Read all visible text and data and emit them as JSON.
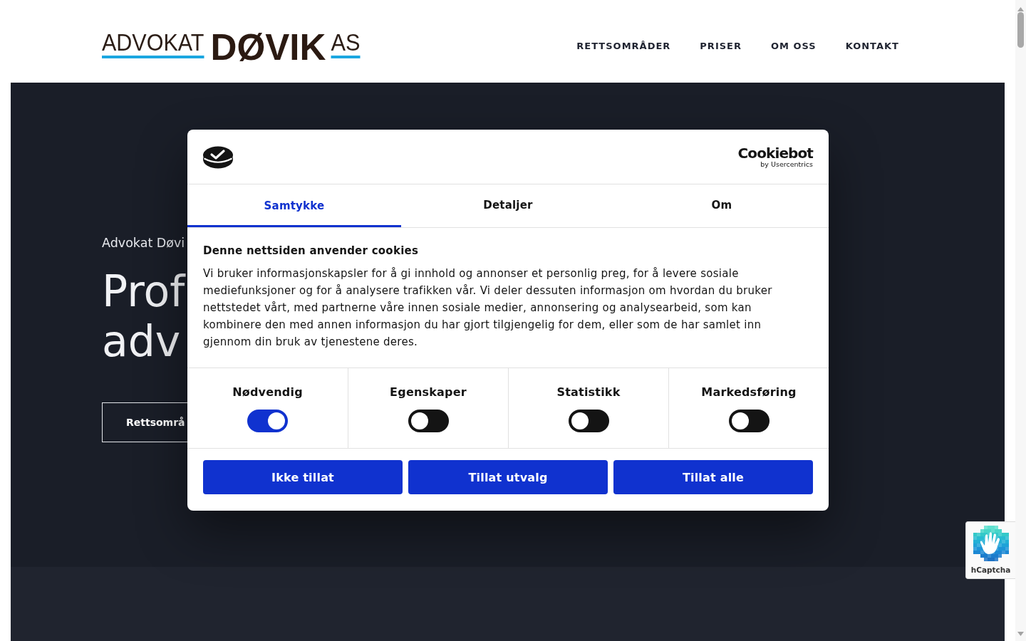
{
  "header": {
    "logo": {
      "words": [
        {
          "text": "ADVOKAT",
          "kind": "thin"
        },
        {
          "text": "DØVIK",
          "kind": "bold"
        },
        {
          "text": "AS",
          "kind": "thin"
        }
      ]
    },
    "nav": [
      "RETTSOMRÅDER",
      "PRISER",
      "OM OSS",
      "KONTAKT"
    ]
  },
  "hero": {
    "eyebrow": "Advokat Døvi",
    "heading_lines": [
      "Prof",
      "adv"
    ],
    "button": "Rettsområ"
  },
  "cookie_dialog": {
    "brand": {
      "name": "Cookiebot",
      "byline": "by Usercentrics"
    },
    "tabs": [
      {
        "label": "Samtykke",
        "selected": true
      },
      {
        "label": "Detaljer",
        "selected": false
      },
      {
        "label": "Om",
        "selected": false
      }
    ],
    "title": "Denne nettsiden anvender cookies",
    "text": "Vi bruker informasjonskapsler for å gi innhold og annonser et personlig preg, for å levere sosiale mediefunksjoner og for å analysere trafikken vår. Vi deler dessuten informasjon om hvordan du bruker nettstedet vårt, med partnerne våre innen sosiale medier, annonsering og analysearbeid, som kan kombinere den med annen informasjon du har gjort tilgjengelig for dem, eller som de har samlet inn gjennom din bruk av tjenestene deres.",
    "categories": [
      {
        "label": "Nødvendig",
        "on": true
      },
      {
        "label": "Egenskaper",
        "on": false
      },
      {
        "label": "Statistikk",
        "on": false
      },
      {
        "label": "Markedsføring",
        "on": false
      }
    ],
    "buttons": [
      "Ikke tillat",
      "Tillat utvalg",
      "Tillat alle"
    ]
  },
  "captcha_badge": {
    "label": "hCaptcha"
  }
}
